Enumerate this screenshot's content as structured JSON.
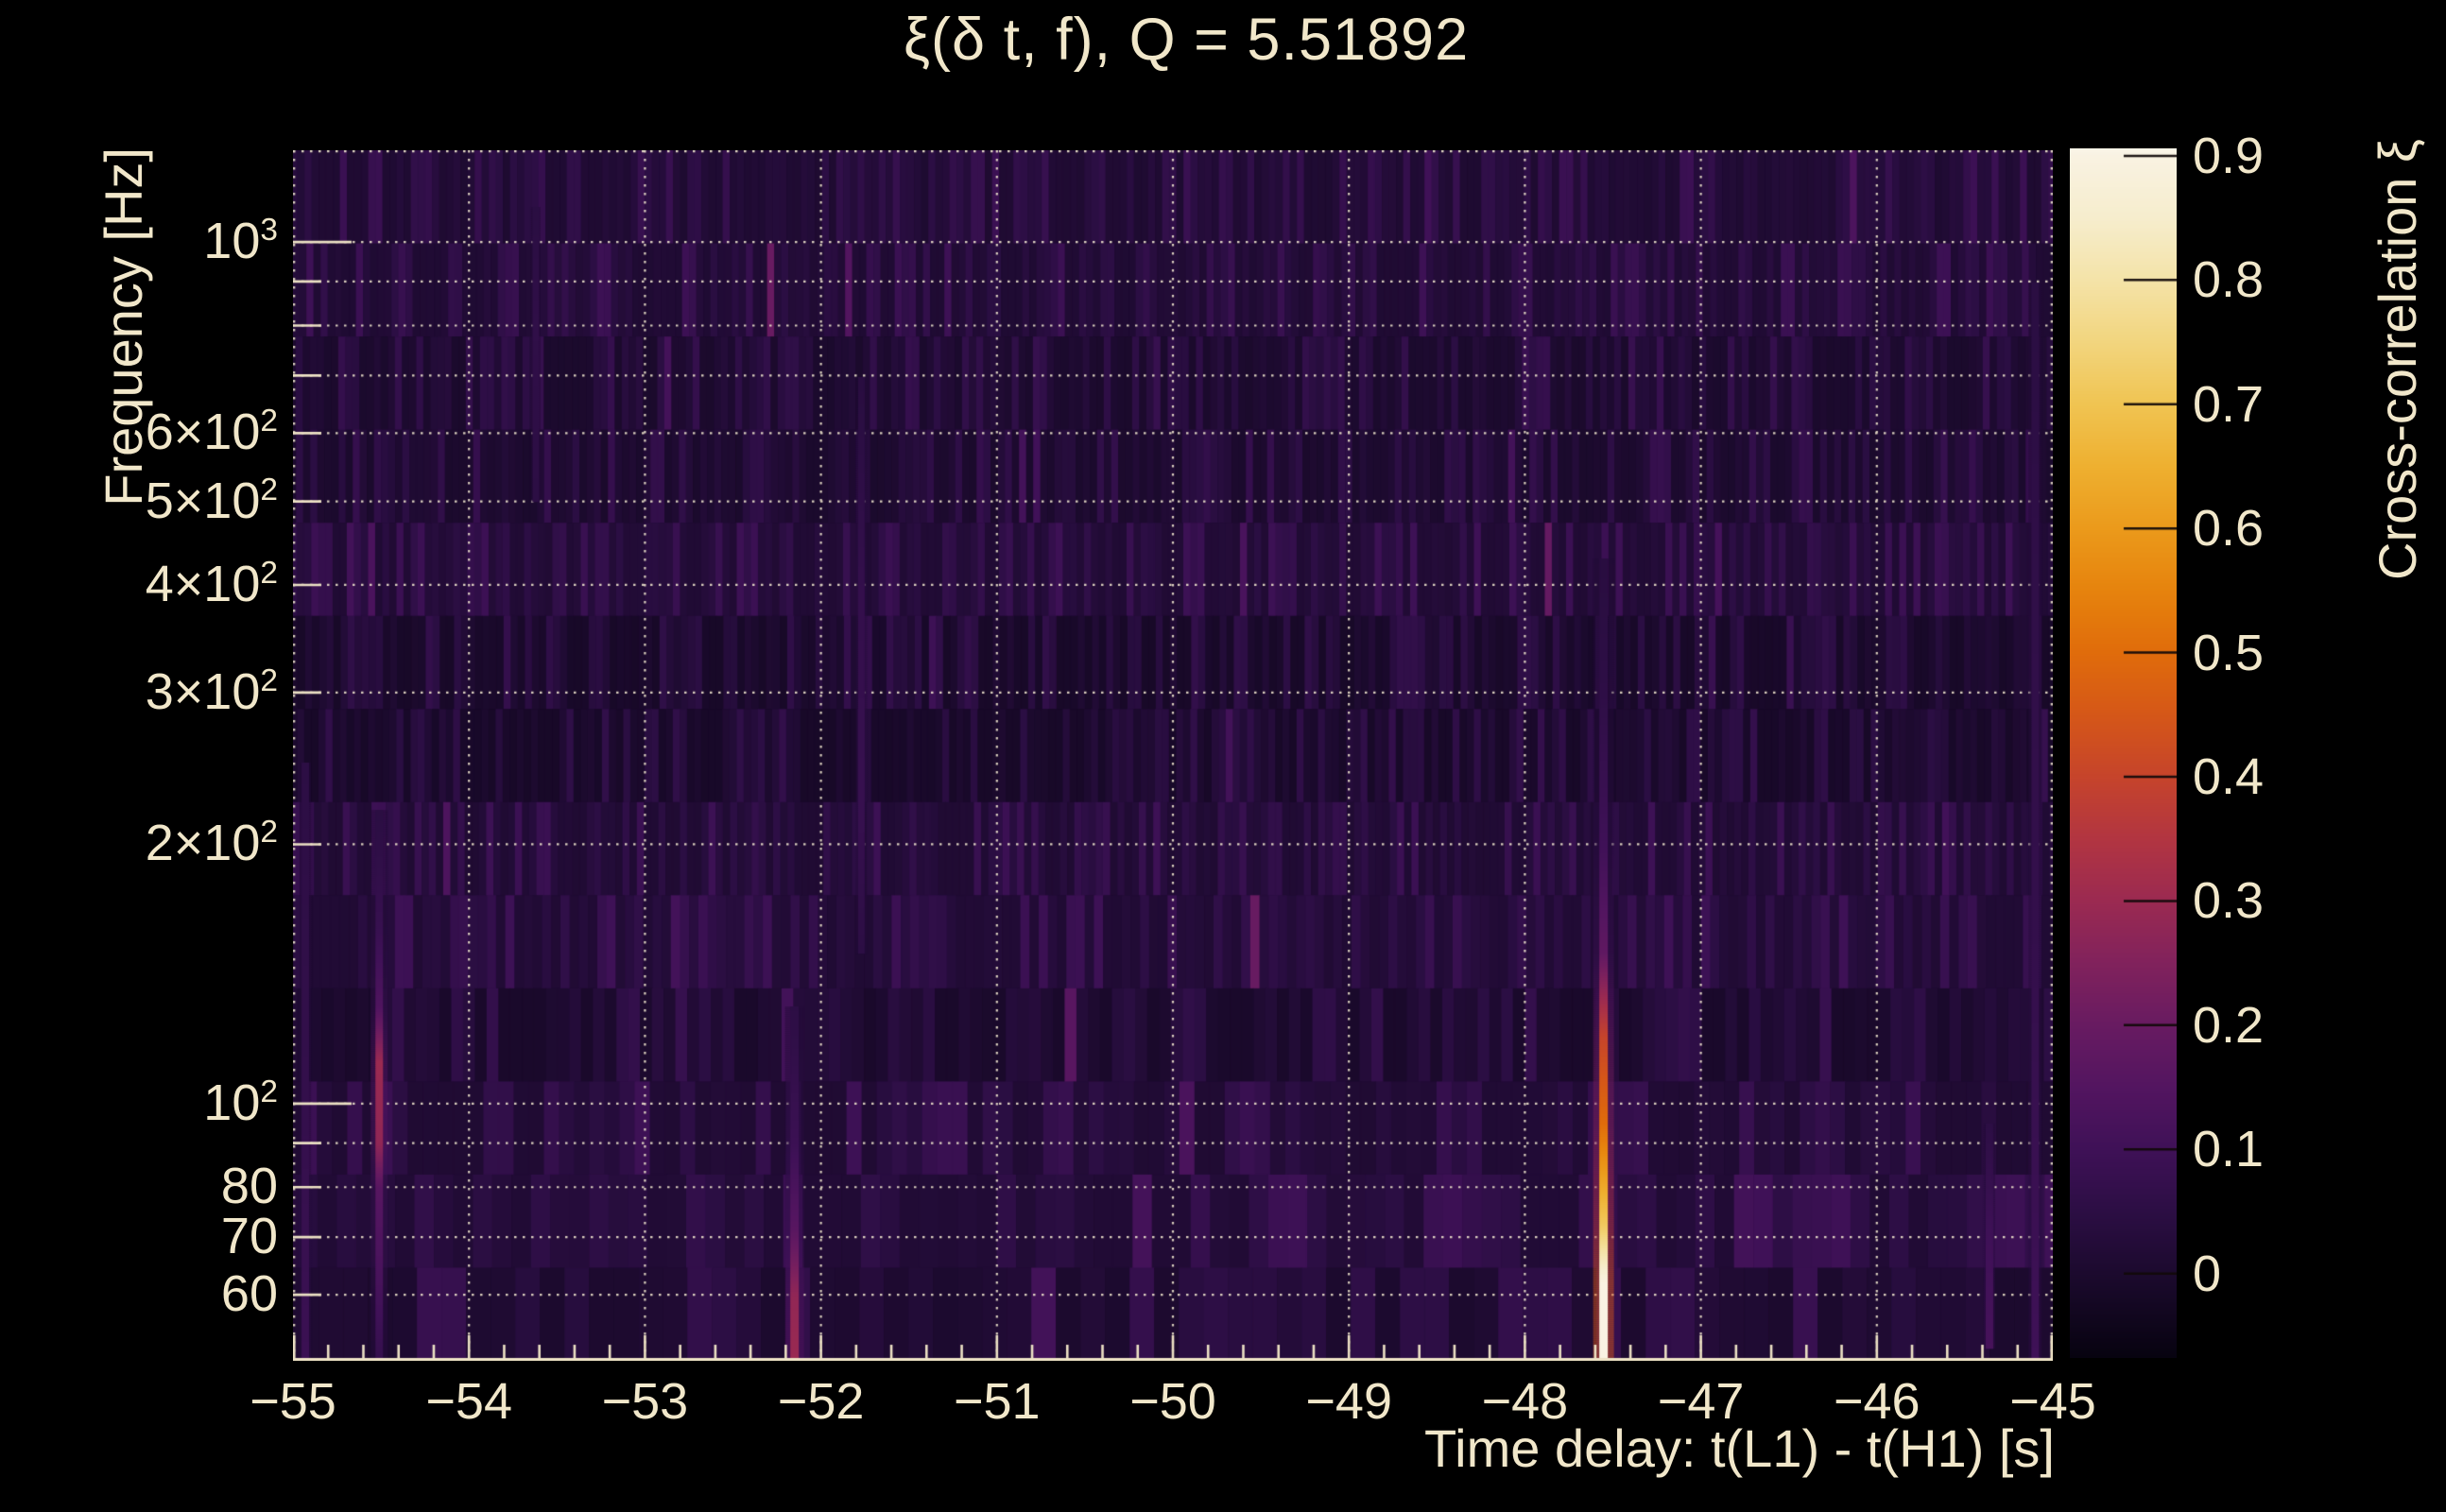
{
  "colors": {
    "background": "#000000",
    "text": "#f1e7ca",
    "grid": "#f0e5c8",
    "axis": "#ece1c4",
    "colorbar_tick": "#140808"
  },
  "chart_data": {
    "type": "heatmap",
    "title": "ξ(δ t, f), Q = 5.51892",
    "xlabel": "Time delay: t(L1) - t(H1) [s]",
    "ylabel": "Frequency [Hz]",
    "zlabel": "Cross-correlation ξ",
    "xlim": [
      -55,
      -45
    ],
    "ylim_hz": [
      50.3,
      1278
    ],
    "zlim": [
      -0.068,
      0.906
    ],
    "x_ticks": [
      {
        "v": -55,
        "label": "−55"
      },
      {
        "v": -54,
        "label": "−54"
      },
      {
        "v": -53,
        "label": "−53"
      },
      {
        "v": -52,
        "label": "−52"
      },
      {
        "v": -51,
        "label": "−51"
      },
      {
        "v": -50,
        "label": "−50"
      },
      {
        "v": -49,
        "label": "−49"
      },
      {
        "v": -48,
        "label": "−48"
      },
      {
        "v": -47,
        "label": "−47"
      },
      {
        "v": -46,
        "label": "−46"
      },
      {
        "v": -45,
        "label": "−45"
      }
    ],
    "x_minor_step": 0.2,
    "y_ticks": [
      {
        "f": 1000,
        "pre": "10",
        "sup": "3"
      },
      {
        "f": 600,
        "pre": "6×10",
        "sup": "2"
      },
      {
        "f": 500,
        "pre": "5×10",
        "sup": "2"
      },
      {
        "f": 400,
        "pre": "4×10",
        "sup": "2"
      },
      {
        "f": 300,
        "pre": "3×10",
        "sup": "2"
      },
      {
        "f": 200,
        "pre": "2×10",
        "sup": "2"
      },
      {
        "f": 100,
        "pre": "10",
        "sup": "2"
      },
      {
        "f": 80,
        "pre": "80",
        "sup": ""
      },
      {
        "f": 70,
        "pre": "70",
        "sup": ""
      },
      {
        "f": 60,
        "pre": "60",
        "sup": ""
      }
    ],
    "grid_freqs": [
      1000,
      900,
      800,
      700,
      600,
      500,
      400,
      300,
      200,
      100,
      90,
      80,
      70,
      60,
      50
    ],
    "major_tick_freqs": [
      1000,
      100
    ],
    "z_ticks": [
      {
        "v": 0.9,
        "label": "0.9"
      },
      {
        "v": 0.8,
        "label": "0.8"
      },
      {
        "v": 0.7,
        "label": "0.7"
      },
      {
        "v": 0.6,
        "label": "0.6"
      },
      {
        "v": 0.5,
        "label": "0.5"
      },
      {
        "v": 0.4,
        "label": "0.4"
      },
      {
        "v": 0.3,
        "label": "0.3"
      },
      {
        "v": 0.2,
        "label": "0.2"
      },
      {
        "v": 0.1,
        "label": "0.1"
      },
      {
        "v": 0.0,
        "label": "0"
      }
    ],
    "colormap_stops": [
      [
        -0.068,
        "#070310"
      ],
      [
        0.0,
        "#1c0a2e"
      ],
      [
        0.05,
        "#2c0e44"
      ],
      [
        0.1,
        "#3f1157"
      ],
      [
        0.15,
        "#531560"
      ],
      [
        0.2,
        "#681b61"
      ],
      [
        0.25,
        "#81225c"
      ],
      [
        0.3,
        "#9b2a51"
      ],
      [
        0.35,
        "#b23541"
      ],
      [
        0.4,
        "#c6442b"
      ],
      [
        0.45,
        "#d55718"
      ],
      [
        0.5,
        "#e06c0b"
      ],
      [
        0.55,
        "#e6830d"
      ],
      [
        0.6,
        "#eb9a1b"
      ],
      [
        0.65,
        "#eeb030"
      ],
      [
        0.7,
        "#f0c452"
      ],
      [
        0.75,
        "#f2d57e"
      ],
      [
        0.8,
        "#f4e3a8"
      ],
      [
        0.85,
        "#f6edcd"
      ],
      [
        0.9,
        "#f9f2e2"
      ],
      [
        0.906,
        "#faf5e9"
      ]
    ],
    "noise": {
      "seed": 20,
      "rows": 13,
      "base": -0.015,
      "amp": 0.085
    },
    "streaks": [
      {
        "t": -47.553,
        "core_w": 9,
        "halo_w": 22,
        "profile": [
          [
            50,
            0.9
          ],
          [
            62,
            0.9
          ],
          [
            72,
            0.72
          ],
          [
            95,
            0.5
          ],
          [
            120,
            0.4
          ],
          [
            150,
            0.18
          ],
          [
            200,
            0.1
          ],
          [
            300,
            0.055
          ],
          [
            430,
            0.04
          ]
        ]
      },
      {
        "t": -54.51,
        "core_w": 8,
        "halo_w": 18,
        "profile": [
          [
            50,
            0.07
          ],
          [
            62,
            0.12
          ],
          [
            80,
            0.16
          ],
          [
            90,
            0.28
          ],
          [
            112,
            0.3
          ],
          [
            130,
            0.14
          ],
          [
            160,
            0.08
          ],
          [
            220,
            0.045
          ]
        ]
      },
      {
        "t": -52.15,
        "core_w": 9,
        "halo_w": 20,
        "profile": [
          [
            50,
            0.3
          ],
          [
            60,
            0.28
          ],
          [
            72,
            0.16
          ],
          [
            90,
            0.09
          ],
          [
            130,
            0.05
          ]
        ]
      },
      {
        "t": -45.1,
        "core_w": 8,
        "halo_w": 14,
        "profile": [
          [
            50,
            0.1
          ],
          [
            70,
            0.09
          ],
          [
            150,
            0.07
          ],
          [
            400,
            0.06
          ],
          [
            900,
            0.045
          ]
        ]
      },
      {
        "t": -45.36,
        "core_w": 8,
        "halo_w": 12,
        "profile": [
          [
            52,
            0.12
          ],
          [
            70,
            0.1
          ],
          [
            95,
            0.05
          ]
        ]
      },
      {
        "t": -51.77,
        "core_w": 7,
        "halo_w": 12,
        "profile": [
          [
            150,
            0.05
          ],
          [
            220,
            0.08
          ],
          [
            400,
            0.07
          ],
          [
            700,
            0.04
          ]
        ]
      },
      {
        "t": -54.93,
        "core_w": 8,
        "halo_w": 12,
        "profile": [
          [
            50,
            0.09
          ],
          [
            100,
            0.07
          ],
          [
            250,
            0.05
          ]
        ]
      },
      {
        "t": -53.62,
        "core_w": 7,
        "halo_w": 10,
        "profile": [
          [
            500,
            0.05
          ],
          [
            800,
            0.06
          ],
          [
            1100,
            0.045
          ]
        ]
      }
    ]
  }
}
